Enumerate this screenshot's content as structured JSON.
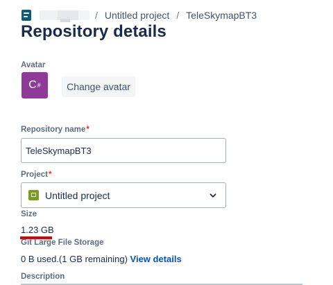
{
  "breadcrumb": {
    "project": "Untitled project",
    "separator": "/",
    "repository": "TeleSkymapBT3"
  },
  "page_title": "Repository details",
  "avatar": {
    "label": "Avatar",
    "text": "C",
    "superscript": "#",
    "color": "#8e3a97",
    "change_button": "Change avatar"
  },
  "repository_name": {
    "label": "Repository name",
    "required_mark": "*",
    "value": "TeleSkymapBT3"
  },
  "project": {
    "label": "Project",
    "required_mark": "*",
    "selected": "Untitled project",
    "icon": "project-folder-icon",
    "icon_color": "#7a9c24"
  },
  "size": {
    "label": "Size",
    "value": "1.23 GB"
  },
  "lfs": {
    "label": "Git Large File Storage",
    "usage": "0 B used.(1 GB remaining)",
    "link": "View details"
  },
  "description": {
    "label": "Description"
  },
  "colors": {
    "link": "#0052cc",
    "required": "#de350b",
    "highlight_underline": "#e30000"
  }
}
